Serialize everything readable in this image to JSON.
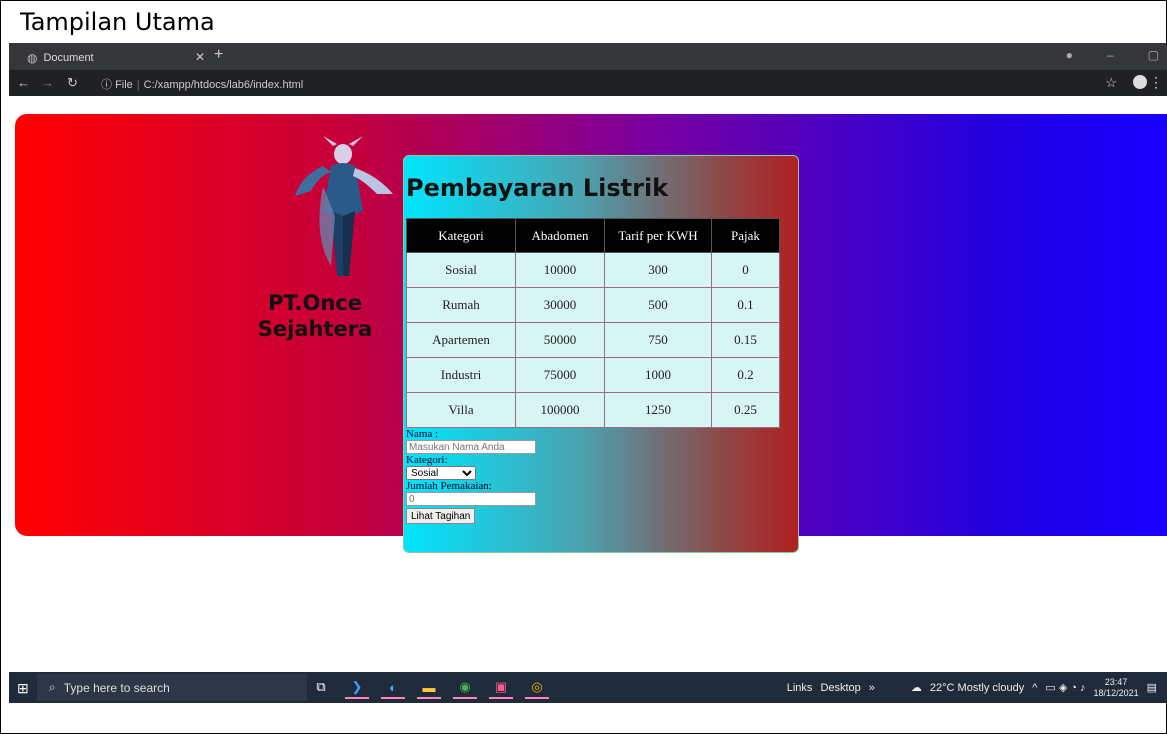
{
  "doc_title": "Tampilan Utama",
  "browser": {
    "tab_title": "Document",
    "address_prefix": "File",
    "url": "C:/xampp/htdocs/lab6/index.html"
  },
  "page": {
    "company": "PT.Once Sejahtera",
    "heading": "Pembayaran Listrik",
    "table": {
      "headers": [
        "Kategori",
        "Abadomen",
        "Tarif per KWH",
        "Pajak"
      ],
      "rows": [
        [
          "Sosial",
          "10000",
          "300",
          "0"
        ],
        [
          "Rumah",
          "30000",
          "500",
          "0.1"
        ],
        [
          "Apartemen",
          "50000",
          "750",
          "0.15"
        ],
        [
          "Industri",
          "75000",
          "1000",
          "0.2"
        ],
        [
          "Villa",
          "100000",
          "1250",
          "0.25"
        ]
      ]
    },
    "form": {
      "nama_label": "Nama :",
      "nama_placeholder": "Masukan Nama Anda",
      "kategori_label": "Kategori:",
      "kategori_selected": "Sosial",
      "jumlah_label": "Jumlah Pemakaian:",
      "jumlah_placeholder": "0",
      "submit_label": "Lihat Tagihan"
    }
  },
  "taskbar": {
    "search_placeholder": "Type here to search",
    "links": "Links",
    "desktop": "Desktop",
    "weather": "22°C  Mostly cloudy",
    "time": "23:47",
    "date": "18/12/2021"
  }
}
